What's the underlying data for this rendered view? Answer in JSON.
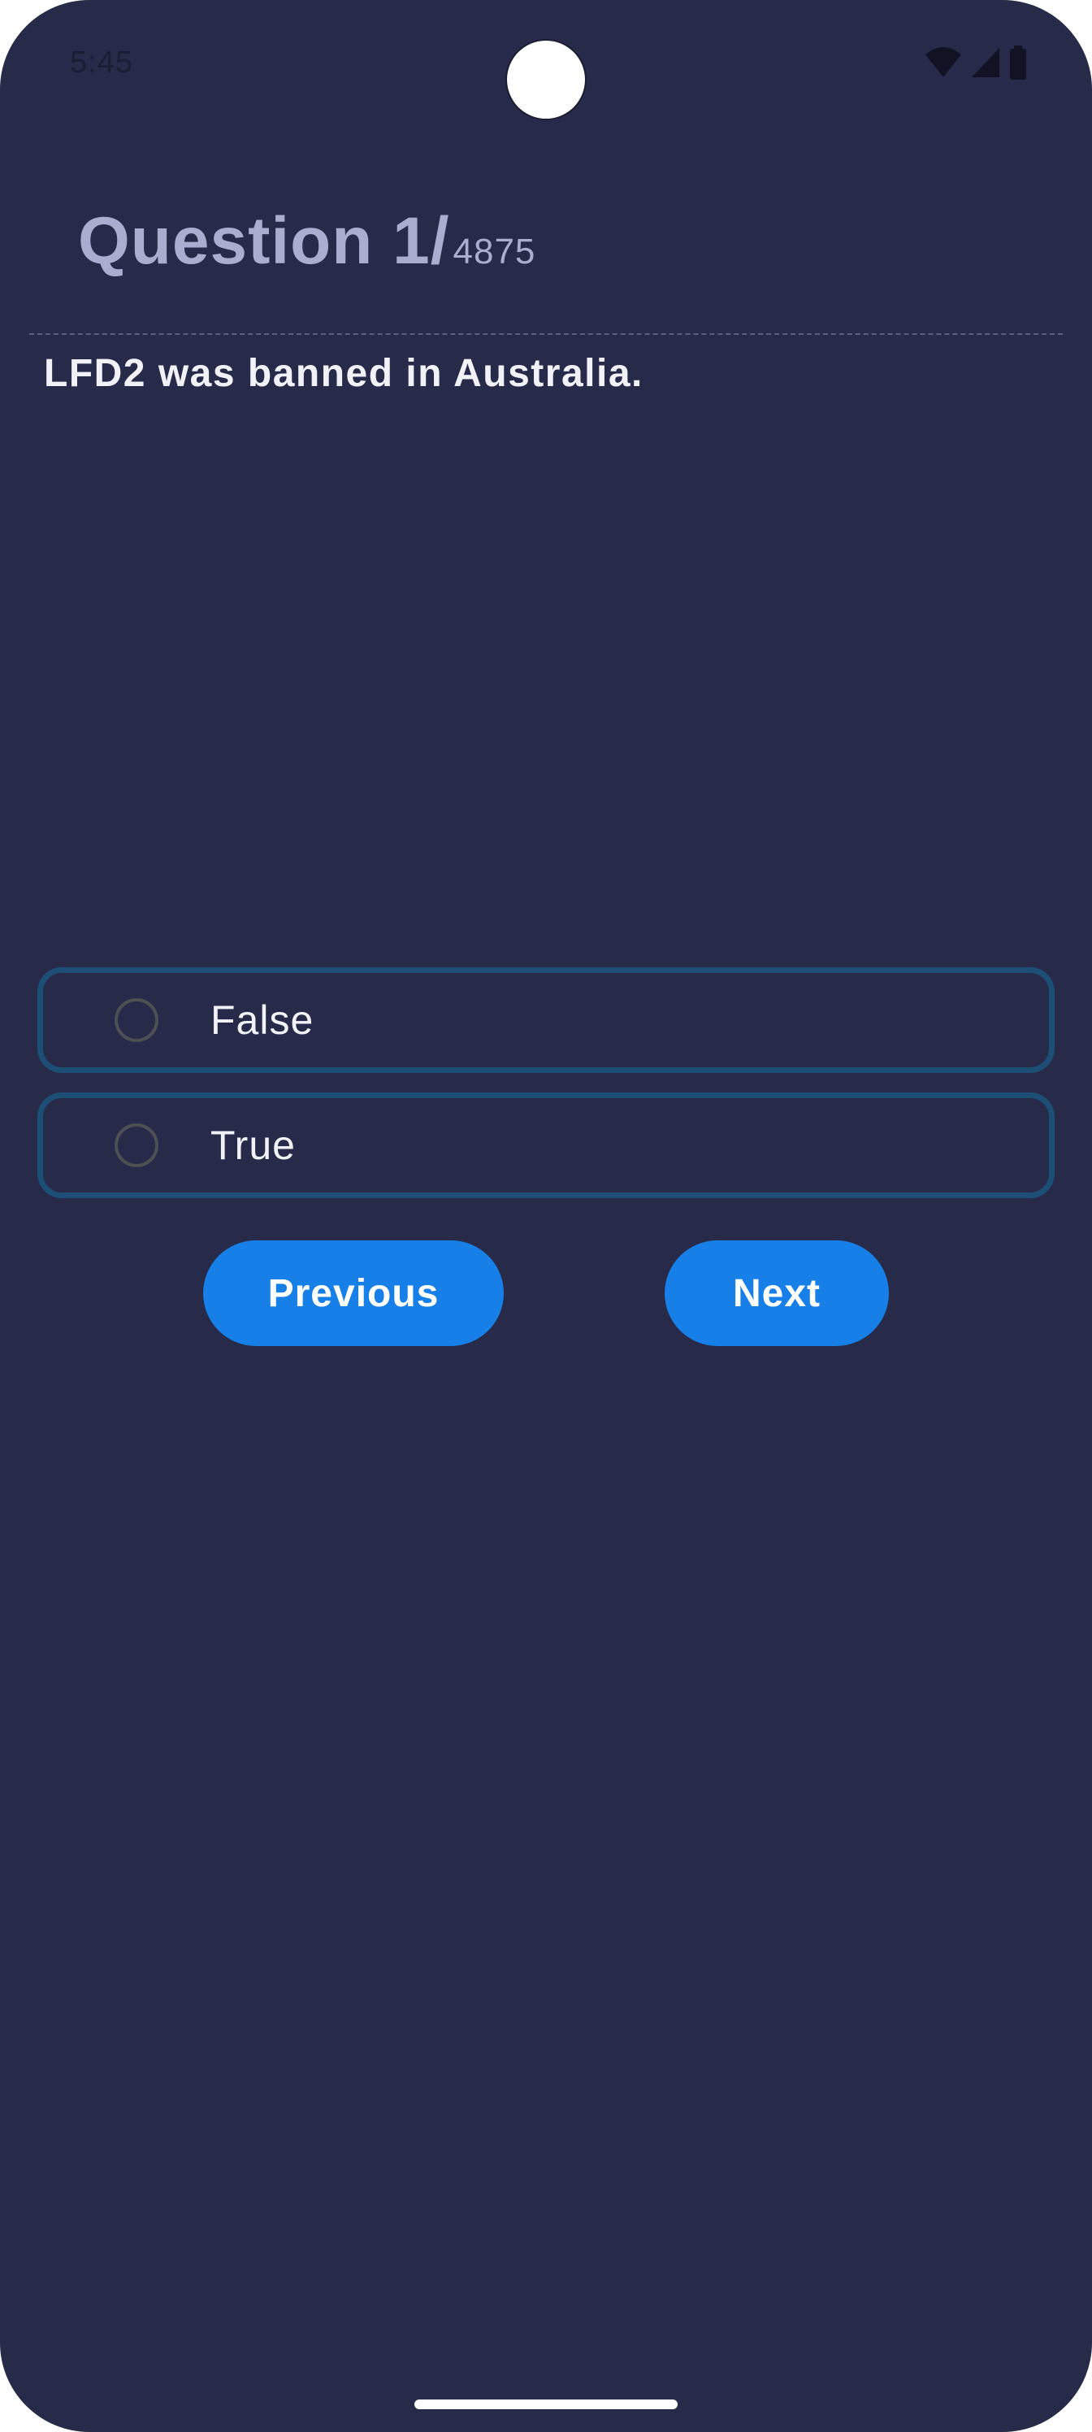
{
  "status_bar": {
    "time": "5:45",
    "icons": [
      "wifi-icon",
      "cellular-signal-icon",
      "battery-icon"
    ]
  },
  "header": {
    "question_label": "Question 1/",
    "total_questions": "4875"
  },
  "question": {
    "text": "LFD2 was banned in Australia."
  },
  "options": [
    {
      "label": "False",
      "selected": false
    },
    {
      "label": "True",
      "selected": false
    }
  ],
  "buttons": {
    "previous_label": "Previous",
    "next_label": "Next"
  },
  "colors": {
    "background": "#272b49",
    "option_border": "#1c4e76",
    "button": "#1680e8",
    "header_text": "#a9aed0"
  }
}
